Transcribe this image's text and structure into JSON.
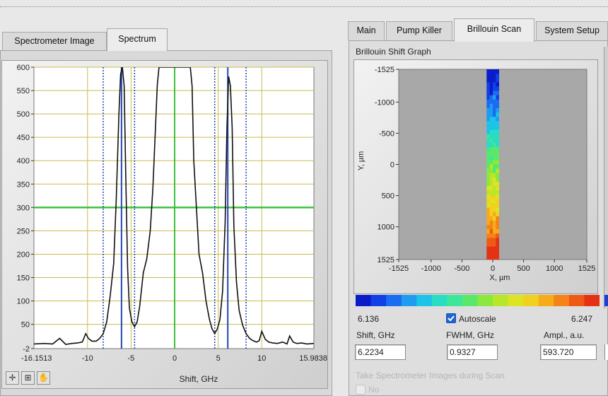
{
  "left_tabs": [
    "Spectrometer Image",
    "Spectrum"
  ],
  "right_tabs": [
    "Main",
    "Pump Killer",
    "Brillouin Scan",
    "System Setup"
  ],
  "brillouin_title": "Brillouin Shift Graph",
  "toolbar_icons": [
    "crosshair-icon",
    "zoom-icon",
    "pan-icon"
  ],
  "spectrum": {
    "x_min_label": "-16.1513",
    "x_max_label": "15.9838",
    "x_ticks": [
      "-10",
      "-5",
      "0",
      "5",
      "10"
    ],
    "y_ticks": [
      "600",
      "550",
      "500",
      "450",
      "400",
      "350",
      "300",
      "250",
      "200",
      "150",
      "100",
      "50",
      "-2"
    ],
    "xlabel": "Shift, GHz"
  },
  "chart_data": [
    {
      "type": "line",
      "xlabel": "Shift, GHz",
      "ylabel": "",
      "xlim": [
        -16.1513,
        15.9838
      ],
      "ylim": [
        -2,
        600
      ],
      "grid": true,
      "cursor_y": 300,
      "vertical_markers_solid": [
        -6.1,
        -0.1,
        6.1
      ],
      "vertical_markers_dotted": [
        -8.2,
        -4.6,
        4.6,
        8.2
      ],
      "series": [
        {
          "x": [
            -16.15,
            -15,
            -14,
            -13.2,
            -12.5,
            -11.8,
            -11.2,
            -10.6,
            -10.2,
            -9.9,
            -9.5,
            -9.0,
            -8.6,
            -8.2,
            -7.8,
            -7.4,
            -7.0,
            -6.7,
            -6.4,
            -6.2,
            -6.0,
            -5.8,
            -5.6,
            -5.4,
            -5.2,
            -4.9,
            -4.6,
            -4.3,
            -4.0,
            -3.6,
            -3.2,
            -2.8,
            -2.5,
            -2.2,
            -2.0,
            -1.8,
            -1.6,
            1.4,
            1.6,
            1.8,
            2.0,
            2.2,
            2.5,
            2.8,
            3.2,
            3.6,
            4.0,
            4.3,
            4.6,
            4.9,
            5.2,
            5.5,
            5.8,
            6.0,
            6.2,
            6.4,
            6.6,
            6.8,
            7.1,
            7.4,
            7.8,
            8.2,
            8.6,
            9.0,
            9.4,
            9.7,
            10.0,
            10.4,
            10.8,
            11.3,
            11.8,
            12.4,
            12.9,
            13.2,
            13.6,
            14.0,
            14.6,
            15.2,
            15.98
          ],
          "y": [
            8,
            9,
            8,
            20,
            7,
            9,
            10,
            12,
            30,
            20,
            14,
            14,
            20,
            30,
            55,
            110,
            180,
            320,
            500,
            585,
            600,
            560,
            360,
            170,
            85,
            55,
            45,
            55,
            90,
            160,
            190,
            250,
            340,
            470,
            560,
            600,
            600,
            600,
            600,
            600,
            560,
            400,
            300,
            200,
            160,
            100,
            60,
            40,
            30,
            40,
            60,
            120,
            270,
            470,
            580,
            560,
            470,
            260,
            140,
            80,
            48,
            30,
            20,
            15,
            12,
            15,
            35,
            18,
            12,
            10,
            9,
            12,
            8,
            25,
            12,
            9,
            10,
            8,
            9
          ]
        }
      ]
    },
    {
      "type": "heatmap",
      "title": "Brillouin Shift Graph",
      "xlabel": "X, µm",
      "ylabel": "Y, µm",
      "xlim": [
        -1525,
        1525
      ],
      "ylim": [
        -1525,
        1525
      ],
      "x_ticks": [
        "-1525",
        "-1000",
        "-500",
        "0",
        "500",
        "1000",
        "1525"
      ],
      "y_ticks": [
        "-1525",
        "-1000",
        "-500",
        "0",
        "500",
        "1000",
        "1525"
      ],
      "data_x_range": [
        -100,
        100
      ],
      "color_min": 6.136,
      "color_max": 6.247
    }
  ],
  "colorbar": {
    "min_label": "6.136",
    "max_label": "6.247",
    "colors": [
      "#0a1cc8",
      "#1040e6",
      "#1a6cf0",
      "#1e9cf2",
      "#1cc4e8",
      "#28ddc4",
      "#3ee69a",
      "#5ae86a",
      "#8ae83e",
      "#b8e62a",
      "#dce424",
      "#f2d01e",
      "#f6ac1a",
      "#f48418",
      "#ee5a16",
      "#e43214"
    ]
  },
  "autoscale": {
    "label": "Autoscale",
    "checked": true
  },
  "fields": {
    "shift_label": "Shift, GHz",
    "shift_value": "6.2234",
    "fwhm_label": "FWHM, GHz",
    "fwhm_value": "0.9327",
    "ampl_label": "Ampl., a.u.",
    "ampl_value": "593.720"
  },
  "take_images": {
    "label": "Take Spectrometer Images during Scan",
    "option": "No"
  },
  "colors": {
    "grid": "#c8bc50",
    "cursor": "#3cc03c",
    "marker": "#2246b4",
    "curve": "#101010",
    "heat_bg": "#a8a8a8"
  }
}
